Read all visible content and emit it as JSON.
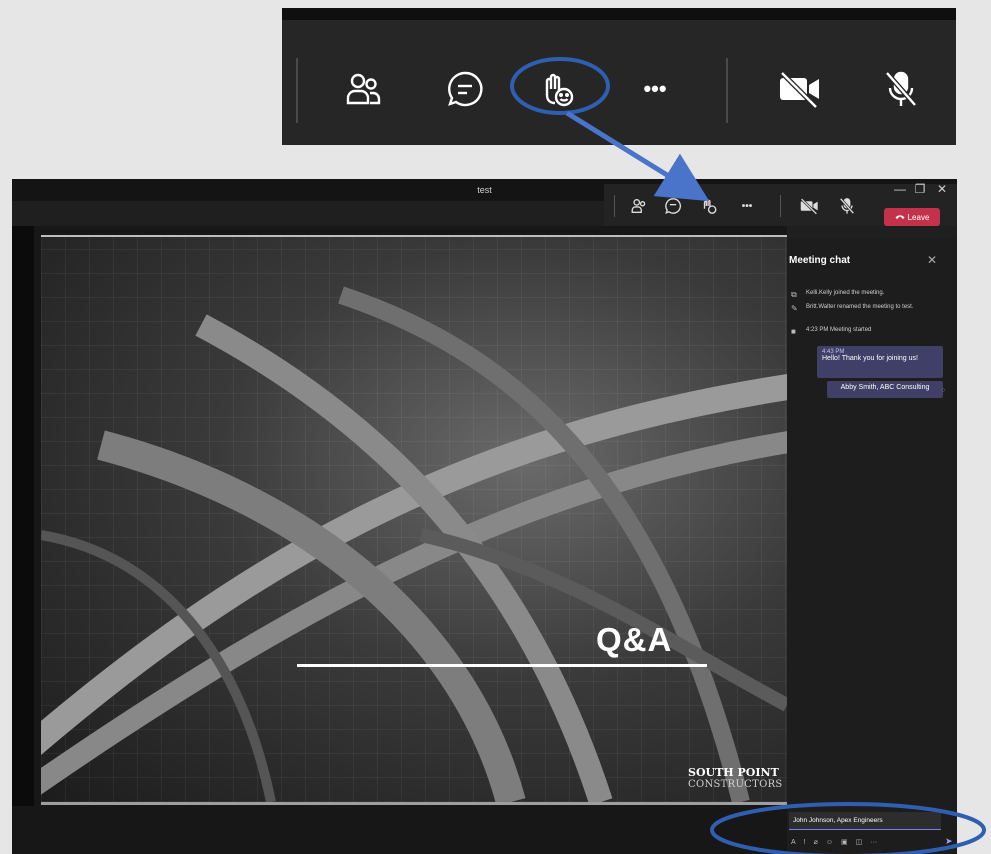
{
  "window": {
    "title": "test",
    "controls": [
      "—",
      "❐",
      "✕"
    ]
  },
  "toolbar": {
    "buttons": [
      "people-icon",
      "chat-icon",
      "raise-hand-reactions-icon",
      "more-options-icon",
      "camera-off-icon",
      "mic-off-icon"
    ],
    "more_label": "•••",
    "leave_label": "Leave",
    "leave_color": "#c4314b"
  },
  "zoom_callout": {
    "more_label": "•••",
    "highlight_color": "#2e5fb0"
  },
  "slide": {
    "heading": "Q&A",
    "logo_line1": "SOUTH POINT",
    "logo_line2": "CONSTRUCTORS"
  },
  "chat": {
    "heading": "Meeting chat",
    "close": "✕",
    "system_messages": [
      {
        "icon": "join-icon",
        "text": "Kelli.Kelly joined the meeting."
      },
      {
        "icon": "pencil-icon",
        "text": "Britt.Walter renamed the meeting to test."
      },
      {
        "icon": "video-icon",
        "text": "4:23 PM   Meeting started"
      }
    ],
    "message_time": "4:43 PM",
    "message_text": "Hello! Thank you for joining us!",
    "message_sender_line": "Abby Smith, ABC Consulting",
    "compose_value": "John Johnson, Apex Engineers",
    "compose_tools": [
      "format-icon",
      "important-icon",
      "attach-icon",
      "emoji-icon",
      "gif-icon",
      "sticker-icon",
      "more-icon"
    ],
    "compose_more": "···",
    "send": "➤",
    "accent": "#3f3f67"
  }
}
